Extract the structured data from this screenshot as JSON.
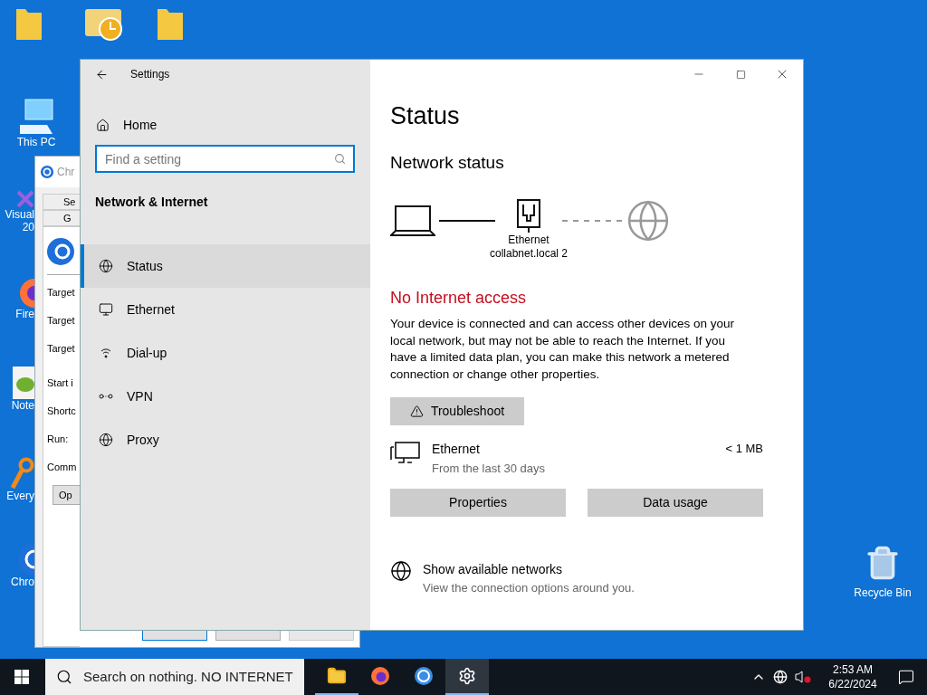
{
  "desktop": {
    "top_icons": [
      {
        "kind": "folder"
      },
      {
        "kind": "mail"
      },
      {
        "kind": "folder"
      }
    ],
    "left_icons": [
      {
        "kind": "pc",
        "label": "This PC"
      },
      {
        "kind": "vs",
        "label": "Visual",
        "label_2": "20"
      },
      {
        "kind": "firefox",
        "label": "Fire"
      },
      {
        "kind": "notepad",
        "label": "Note"
      },
      {
        "kind": "search",
        "label": "Every"
      },
      {
        "kind": "chrome",
        "label": "Chro"
      }
    ],
    "right_icons": [
      {
        "kind": "recycle",
        "label": "Recycle Bin"
      }
    ]
  },
  "background_window": {
    "title": "Chr",
    "tabs": [
      "Se",
      "G"
    ],
    "fields": [
      "Target",
      "Target",
      "Target",
      "Start i",
      "Shortc",
      "Run:",
      "Comm"
    ],
    "button": "Op"
  },
  "settings": {
    "title": "Settings",
    "home": "Home",
    "search": {
      "placeholder": "Find a setting"
    },
    "section": "Network & Internet",
    "nav": [
      {
        "label": "Status",
        "kind": "status",
        "selected": true
      },
      {
        "label": "Ethernet",
        "kind": "ethernet",
        "selected": false
      },
      {
        "label": "Dial-up",
        "kind": "dialup",
        "selected": false
      },
      {
        "label": "VPN",
        "kind": "vpn",
        "selected": false
      },
      {
        "label": "Proxy",
        "kind": "proxy",
        "selected": false
      }
    ],
    "heading": "Status",
    "subheading": "Network status",
    "diagram": {
      "adapter": "Ethernet",
      "network": "collabnet.local 2",
      "internet_connected": false
    },
    "alert": "No Internet access",
    "message": "Your device is connected and can access other devices on your local network, but may not be able to reach the Internet. If you have a limited data plan, you can make this network a metered connection or change other properties.",
    "troubleshoot": "Troubleshoot",
    "connection": {
      "name": "Ethernet",
      "detail": "From the last 30 days",
      "usage": "< 1 MB"
    },
    "buttons": [
      "Properties",
      "Data usage"
    ],
    "networks": {
      "title": "Show available networks",
      "detail": "View the connection options around you."
    }
  },
  "taskbar": {
    "search": "Search on nothing. NO INTERNET",
    "apps": [
      {
        "kind": "explorer",
        "selected": false
      },
      {
        "kind": "firefox",
        "selected": false
      },
      {
        "kind": "chrome",
        "selected": false
      },
      {
        "kind": "settings",
        "selected": true
      }
    ],
    "time": "2:53 AM",
    "date": "6/22/2024"
  }
}
